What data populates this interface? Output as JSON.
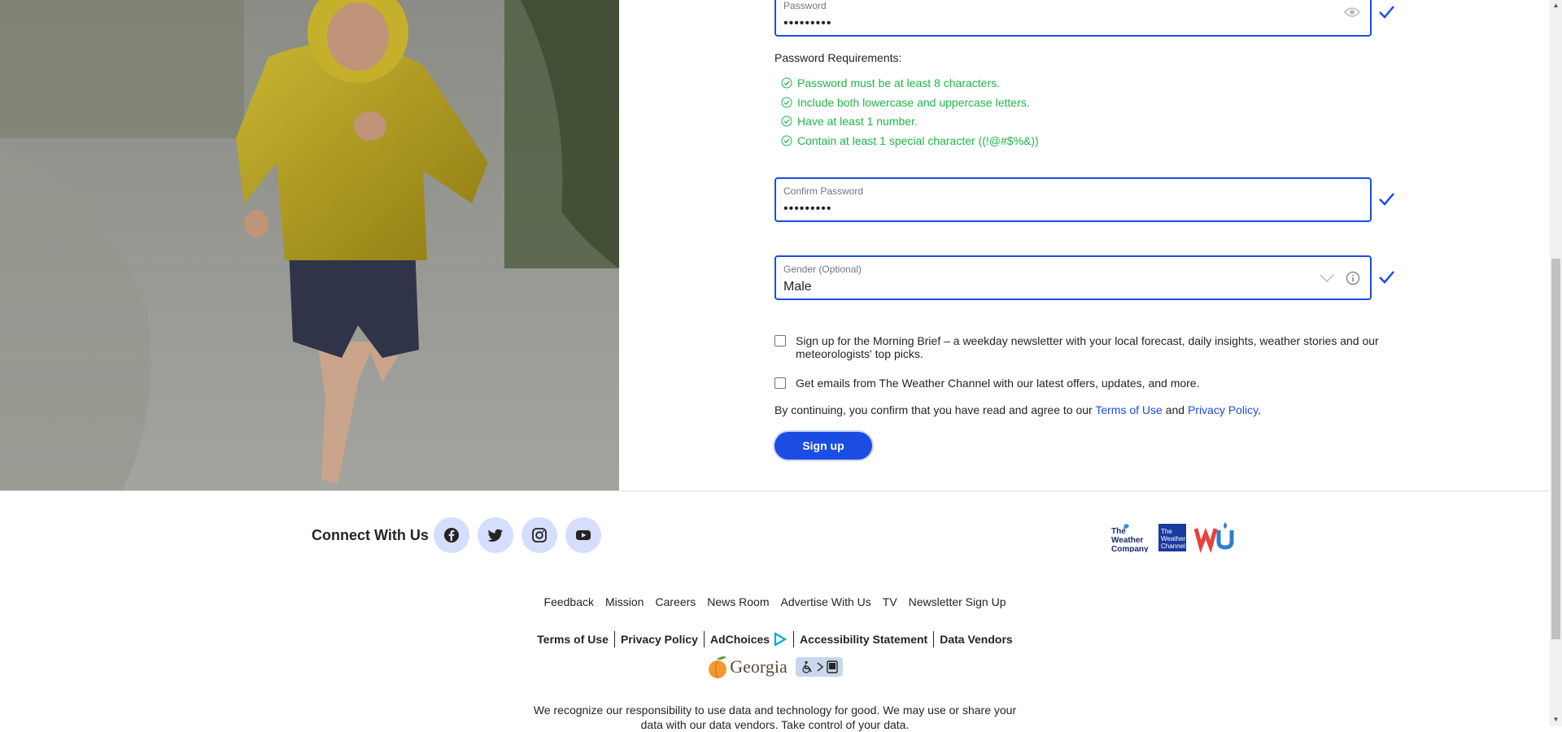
{
  "form": {
    "password": {
      "label": "Password",
      "value": "•••••••••"
    },
    "requirements_title": "Password Requirements:",
    "requirements": [
      "Password must be at least 8 characters.",
      "Include both lowercase and uppercase letters.",
      "Have at least 1 number.",
      "Contain at least 1 special character ((!@#$%&))"
    ],
    "confirm_password": {
      "label": "Confirm Password",
      "value": "•••••••••"
    },
    "gender": {
      "label": "Gender (Optional)",
      "value": "Male"
    },
    "checkboxes": [
      "Sign up for the Morning Brief – a weekday newsletter with your local forecast, daily insights, weather stories and our meteorologists' top picks.",
      "Get emails from The Weather Channel with our latest offers, updates, and more."
    ],
    "legal": {
      "prefix": "By continuing, you confirm that you have read and agree to our ",
      "terms": "Terms of Use",
      "and": " and ",
      "privacy": "Privacy Policy",
      "suffix": "."
    },
    "signup_label": "Sign up"
  },
  "footer": {
    "connect": "Connect With Us",
    "social": [
      "facebook-icon",
      "twitter-icon",
      "instagram-icon",
      "youtube-icon"
    ],
    "brand_logos": {
      "weather_company": "The Weather Company",
      "weather_channel": "The Weather Channel",
      "wu": "WU"
    },
    "links": [
      "Feedback",
      "Mission",
      "Careers",
      "News Room",
      "Advertise With Us",
      "TV",
      "Newsletter Sign Up"
    ],
    "legal_links": [
      "Terms of Use",
      "Privacy Policy",
      "AdChoices",
      "Accessibility Statement",
      "Data Vendors"
    ],
    "georgia": "Georgia",
    "recognize_text": "We recognize our responsibility to use data and technology for good. We may use or share your",
    "recognize_text2": "data with our data vendors. Take control of your data."
  },
  "colors": {
    "accent": "#1b4de4",
    "success": "#21b548",
    "social_bg": "#d5defc"
  }
}
